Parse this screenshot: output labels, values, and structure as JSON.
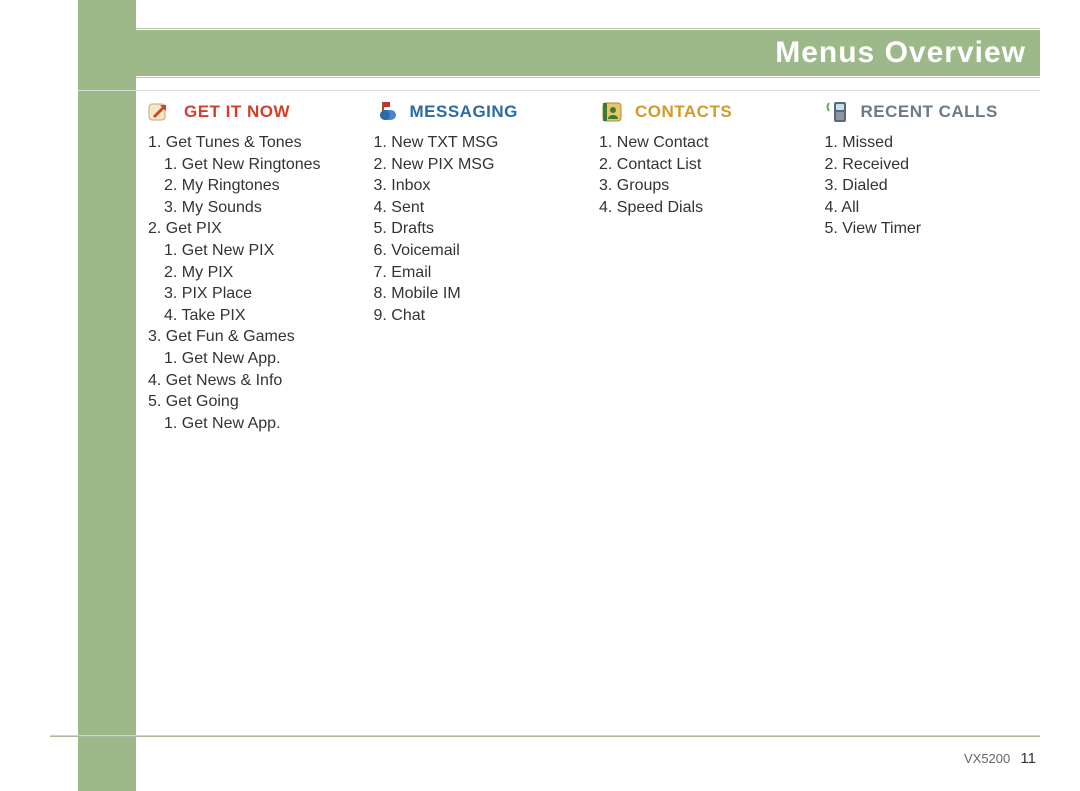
{
  "header": {
    "title": "Menus Overview"
  },
  "columns": [
    {
      "title": "Get It Now",
      "items": [
        "1. Get Tunes & Tones",
        "1. Get New Ringtones",
        "2. My Ringtones",
        "3. My Sounds",
        "2. Get PIX",
        "1. Get New PIX",
        "2. My PIX",
        "3. PIX Place",
        "4. Take PIX",
        "3. Get Fun & Games",
        "1. Get New App.",
        "4. Get News & Info",
        "5. Get Going",
        "1. Get New App."
      ]
    },
    {
      "title": "Messaging",
      "items": [
        "1. New TXT MSG",
        "2. New PIX MSG",
        "3. Inbox",
        "4. Sent",
        "5. Drafts",
        "6. Voicemail",
        "7. Email",
        "8. Mobile IM",
        "9. Chat"
      ]
    },
    {
      "title": "Contacts",
      "items": [
        "1. New Contact",
        "2. Contact List",
        "3. Groups",
        "4. Speed Dials"
      ]
    },
    {
      "title": "Recent Calls",
      "items": [
        "1. Missed",
        "2. Received",
        "3. Dialed",
        "4. All",
        "5. View Timer"
      ]
    }
  ],
  "footer": {
    "model": "VX5200",
    "page": "11"
  }
}
